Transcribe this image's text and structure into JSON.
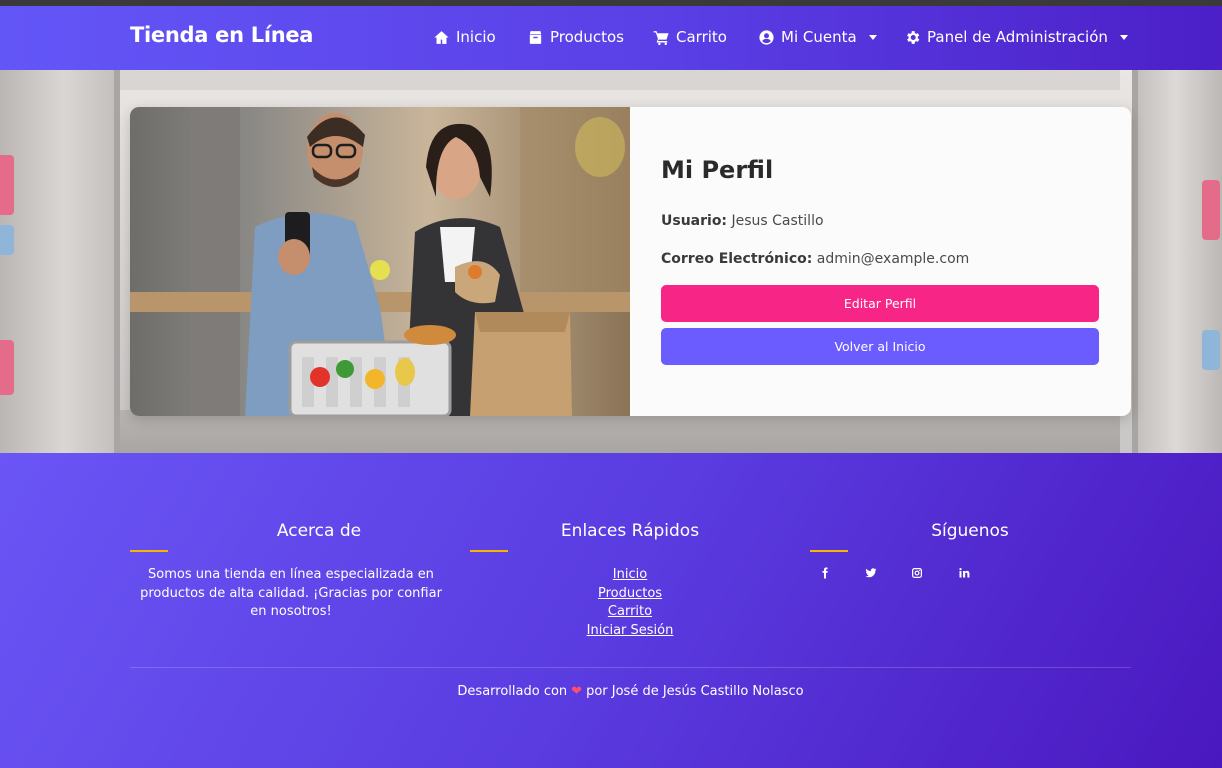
{
  "navbar": {
    "brand": "Tienda en Línea",
    "items": [
      {
        "label": "Inicio",
        "icon": "home-icon"
      },
      {
        "label": "Productos",
        "icon": "box-icon"
      },
      {
        "label": "Carrito",
        "icon": "cart-icon"
      },
      {
        "label": "Mi Cuenta",
        "icon": "user-circle-icon"
      },
      {
        "label": "Panel de Administración",
        "icon": "gear-icon"
      }
    ]
  },
  "profile": {
    "title": "Mi Perfil",
    "user_label": "Usuario:",
    "user_value": "Jesus Castillo",
    "email_label": "Correo Electrónico:",
    "email_value": "admin@example.com",
    "edit_button": "Editar Perfil",
    "home_button": "Volver al Inicio"
  },
  "footer": {
    "about": {
      "title": "Acerca de",
      "text": "Somos una tienda en línea especializada en productos de alta calidad. ¡Gracias por confiar en nosotros!"
    },
    "links": {
      "title": "Enlaces Rápidos",
      "items": [
        "Inicio",
        "Productos",
        "Carrito",
        "Iniciar Sesión"
      ]
    },
    "social": {
      "title": "Síguenos",
      "icons": [
        "facebook-icon",
        "twitter-icon",
        "instagram-icon",
        "linkedin-icon"
      ]
    },
    "credit_prefix": "Desarrollado con",
    "credit_heart": "❤",
    "credit_suffix": "por José de Jesús Castillo Nolasco"
  },
  "colors": {
    "accent_pink": "#f72585",
    "accent_purple": "#6a5cff",
    "rule_yellow": "#f7b500"
  }
}
